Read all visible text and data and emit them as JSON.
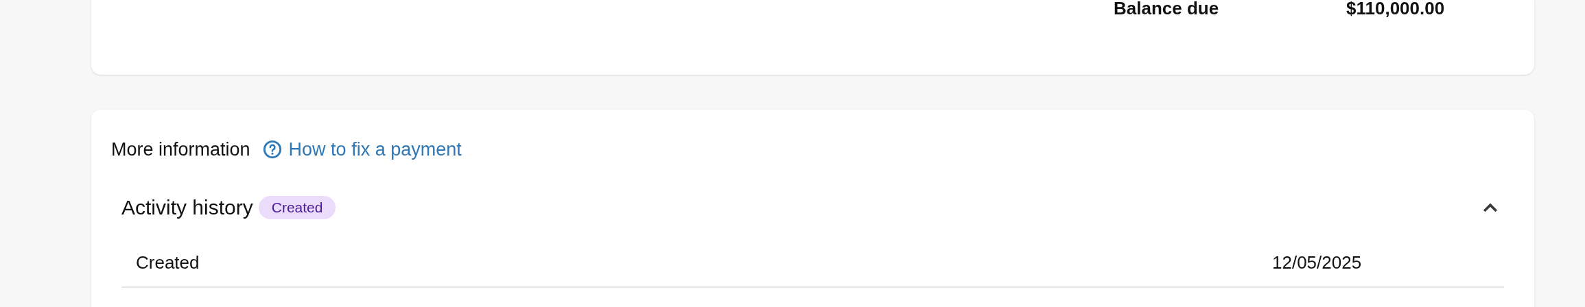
{
  "summary": {
    "label": "Balance due",
    "amount": "$110,000.00"
  },
  "more_info": {
    "title": "More information",
    "link": "How to fix a payment"
  },
  "activity_history": {
    "title": "Activity history",
    "badge": "Created",
    "expanded": true,
    "rows": [
      {
        "event": "Created",
        "date": "12/05/2025"
      }
    ]
  }
}
